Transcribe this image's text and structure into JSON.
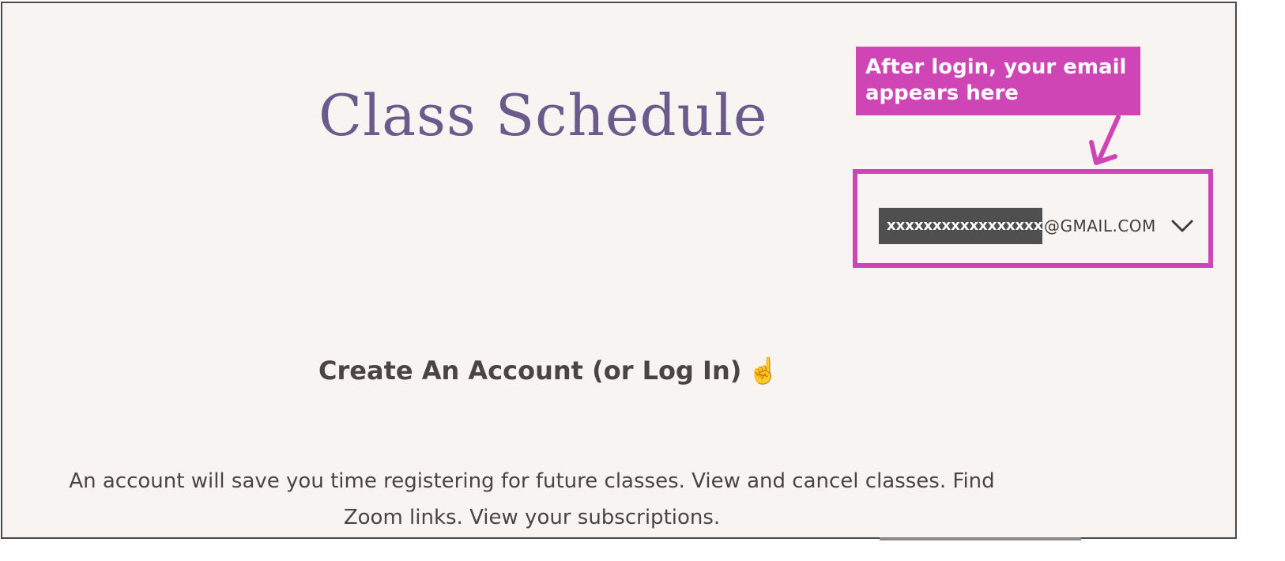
{
  "page": {
    "title": "Class Schedule"
  },
  "callout": {
    "line1": "After login, your email",
    "line2": "appears here"
  },
  "account": {
    "email_redacted": "xxxxxxxxxxxxxxxxx",
    "email_domain": "@GMAIL.COM",
    "menu_icon": "chevron-down-icon"
  },
  "account_section": {
    "heading": "Create An Account (or Log In)",
    "emoji": "☝️",
    "description": "An account will save you time registering for future classes. View and cancel classes. Find Zoom links. View your subscriptions."
  },
  "colors": {
    "background": "#f8f4f1",
    "title": "#6b5b8c",
    "annotation": "#cf45b6",
    "redaction": "#4f4f4f",
    "text": "#4a4544"
  }
}
